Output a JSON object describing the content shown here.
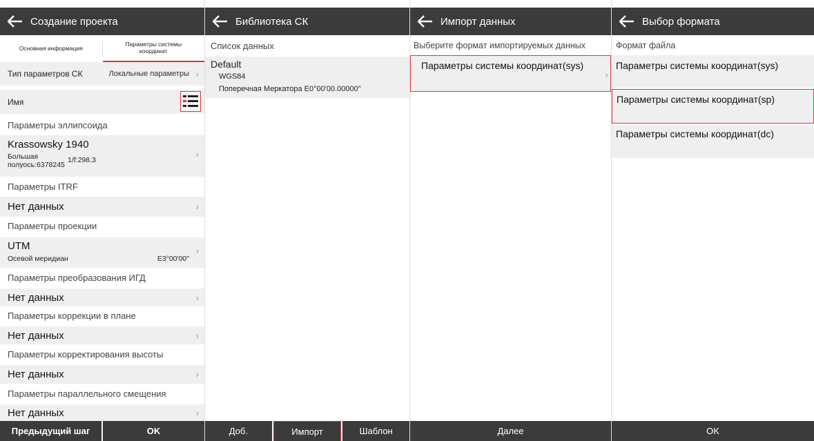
{
  "colors": {
    "topbar": "#3b3b3b",
    "accent": "#d9363e",
    "row_bg": "#efefef"
  },
  "screen1": {
    "title": "Создание проекта",
    "tabs": [
      "Основная информация",
      "Параметры системы координат"
    ],
    "cs_type_label": "Тип параметров СК",
    "cs_type_value": "Локальные параметры",
    "name_label": "Имя",
    "ellipsoid": {
      "section": "Параметры эллипсоида",
      "name": "Krassowsky 1940",
      "semi_major": "Большая полуось:6378245",
      "flattening": "1/f:298.3"
    },
    "itrf": {
      "section": "Параметры ITRF",
      "value": "Нет данных"
    },
    "projection": {
      "section": "Параметры проекции",
      "name": "UTM",
      "meridian_label": "Осевой меридиан",
      "meridian_value": "E3°00'00\""
    },
    "datum": {
      "section": "Параметры преобразования ИГД",
      "value": "Нет данных"
    },
    "plane": {
      "section": "Параметры коррекции в плане",
      "value": "Нет данных"
    },
    "height": {
      "section": "Параметры корректирования высоты",
      "value": "Нет данных"
    },
    "shift": {
      "section": "Параметры параллельного смещения",
      "value": "Нет данных"
    },
    "buttons": {
      "prev": "Предыдущий шаг",
      "ok": "OK"
    }
  },
  "screen2": {
    "title": "Библиотека СК",
    "list_label": "Список данных",
    "item": {
      "name": "Default",
      "datum": "WGS84",
      "projection": "Поперечная Меркатора E0°00'00.00000\""
    },
    "buttons": {
      "add": "Доб.",
      "import": "Импорт",
      "template": "Шаблон"
    }
  },
  "screen3": {
    "title": "Импорт данных",
    "prompt": "Выберите формат импортируемых данных",
    "option": "Параметры системы координат(sys)",
    "buttons": {
      "next": "Далее"
    }
  },
  "screen4": {
    "title": "Выбор формата",
    "label": "Формат файла",
    "options": [
      "Параметры системы координат(sys)",
      "Параметры системы координат(sp)",
      "Параметры системы координат(dc)"
    ],
    "buttons": {
      "ok": "OK"
    }
  }
}
